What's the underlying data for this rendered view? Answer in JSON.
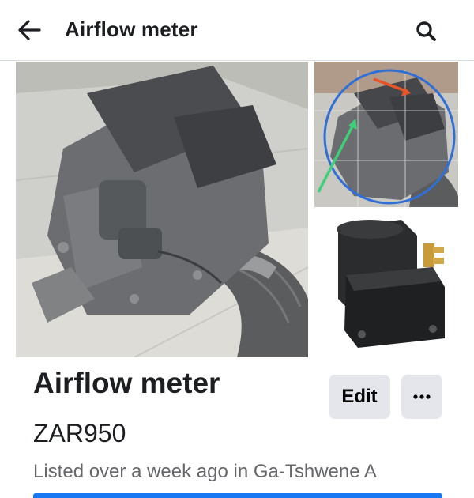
{
  "header": {
    "title": "Airflow meter",
    "back_icon": "arrow-left-icon",
    "search_icon": "search-icon"
  },
  "listing": {
    "title": "Airflow meter",
    "price": "ZAR950",
    "meta": "Listed over a week ago in Ga-Tshwene A",
    "edit_label": "Edit",
    "more_icon": "more-dots-icon"
  },
  "photos": [
    {
      "subject": "airflow meter housing"
    },
    {
      "subject": "airflow meter with annotations"
    },
    {
      "subject": "ignition coil"
    }
  ],
  "colors": {
    "accent": "#1877f2",
    "button_bg": "#e4e6eb",
    "meta_text": "#65676b"
  }
}
